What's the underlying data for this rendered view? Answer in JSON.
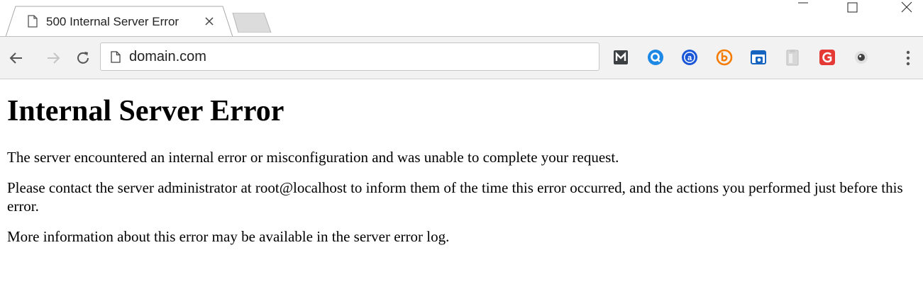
{
  "browser": {
    "tab": {
      "title": "500 Internal Server Error",
      "close_glyph": "×"
    },
    "window_controls": {
      "minimize_icon": "minimize-icon",
      "maximize_icon": "maximize-icon",
      "close_icon": "close-icon"
    },
    "omnibox": {
      "value": "domain.com",
      "page_icon": "page-icon"
    },
    "extensions": [
      {
        "icon": "m-extension-icon",
        "color": "#3c4043"
      },
      {
        "icon": "q-extension-icon",
        "color": "#1e88e5"
      },
      {
        "icon": "a-extension-icon",
        "color": "#1a57d6"
      },
      {
        "icon": "b-extension-icon",
        "color": "#f57c00"
      },
      {
        "icon": "camera-extension-icon",
        "color": "#1565c0"
      },
      {
        "icon": "clipboard-extension-icon",
        "color": "#bdbdbd"
      },
      {
        "icon": "g-extension-icon",
        "color": "#e53935"
      },
      {
        "icon": "eye-extension-icon",
        "color": "#424242"
      }
    ]
  },
  "page": {
    "heading": "Internal Server Error",
    "paragraph1": "The server encountered an internal error or misconfiguration and was unable to complete your request.",
    "paragraph2": "Please contact the server administrator at root@localhost to inform them of the time this error occurred, and the actions you performed just before this error.",
    "paragraph3": "More information about this error may be available in the server error log."
  }
}
